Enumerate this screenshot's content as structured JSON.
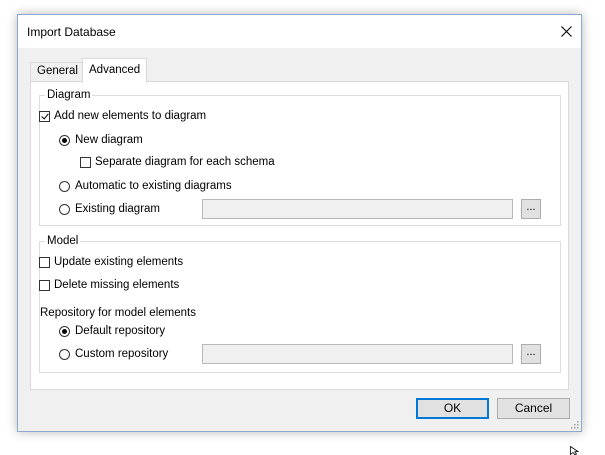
{
  "window": {
    "title": "Import Database"
  },
  "tabs": [
    {
      "label": "General",
      "active": false
    },
    {
      "label": "Advanced",
      "active": true
    }
  ],
  "diagram_group": {
    "title": "Diagram",
    "add_new_elements": {
      "label": "Add new elements to diagram",
      "checked": true
    },
    "new_diagram": {
      "label": "New diagram",
      "selected": true
    },
    "separate_diagram": {
      "label": "Separate diagram for each schema",
      "checked": false
    },
    "automatic_existing": {
      "label": "Automatic to existing diagrams",
      "selected": false
    },
    "existing_diagram": {
      "label": "Existing diagram",
      "selected": false,
      "value": "",
      "browse_label": "..."
    }
  },
  "model_group": {
    "title": "Model",
    "update_existing": {
      "label": "Update existing elements",
      "checked": false
    },
    "delete_missing": {
      "label": "Delete missing elements",
      "checked": false
    },
    "repository_label": "Repository for model elements",
    "default_repository": {
      "label": "Default repository",
      "selected": true
    },
    "custom_repository": {
      "label": "Custom repository",
      "selected": false,
      "value": "",
      "browse_label": "..."
    }
  },
  "buttons": {
    "ok": "OK",
    "cancel": "Cancel"
  }
}
